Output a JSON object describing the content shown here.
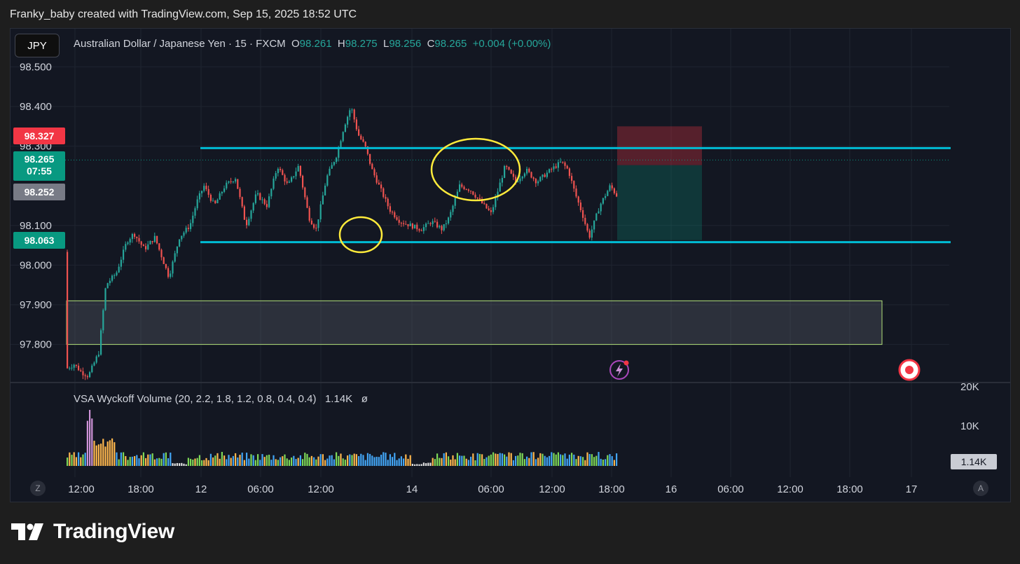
{
  "header": {
    "attribution": "Franky_baby created with TradingView.com, Sep 15, 2025 18:52 UTC"
  },
  "chart": {
    "symbol_button": "JPY",
    "legend": {
      "title": "Australian Dollar / Japanese Yen · 15 · FXCM",
      "o_label": "O",
      "o_value": "98.261",
      "h_label": "H",
      "h_value": "98.275",
      "l_label": "L",
      "l_value": "98.256",
      "c_label": "C",
      "c_value": "98.265",
      "change": "+0.004 (+0.00%)"
    },
    "price_tags": {
      "stop": "98.327",
      "last": "98.265",
      "countdown": "07:55",
      "prev": "98.252",
      "target": "98.063"
    },
    "volume_indicator": {
      "legend": "VSA Wyckoff Volume (20, 2.2, 1.8, 1.2, 0.8, 0.4, 0.4)",
      "value": "1.14K",
      "flag": "ø",
      "y_ticks": [
        "20K",
        "10K"
      ],
      "last_value_tag": "1.14K"
    },
    "corner_buttons": {
      "left": "Z",
      "right": "A"
    },
    "colors": {
      "up": "#26a69a",
      "down": "#ef5350",
      "level": "#00bcd4",
      "highlight": "#ffeb3b",
      "zone_border": "#b2e07a"
    }
  },
  "footer": {
    "brand": "TradingView"
  },
  "chart_data": {
    "type": "candlestick",
    "instrument": "Australian Dollar / Japanese Yen",
    "interval": "15",
    "y_ticks": [
      "98.500",
      "98.400",
      "98.300",
      "98.100",
      "98.000",
      "97.900",
      "97.800"
    ],
    "x_ticks": [
      "12:00",
      "18:00",
      "12",
      "06:00",
      "12:00",
      "14",
      "06:00",
      "12:00",
      "18:00",
      "16",
      "06:00",
      "12:00",
      "18:00",
      "17"
    ],
    "ylim": [
      97.71,
      98.53
    ],
    "resistance": 98.295,
    "support": 98.058,
    "demand_zone": [
      97.8,
      97.91
    ],
    "position": {
      "stop": 98.327,
      "entry": 98.252,
      "target": 98.063
    }
  }
}
